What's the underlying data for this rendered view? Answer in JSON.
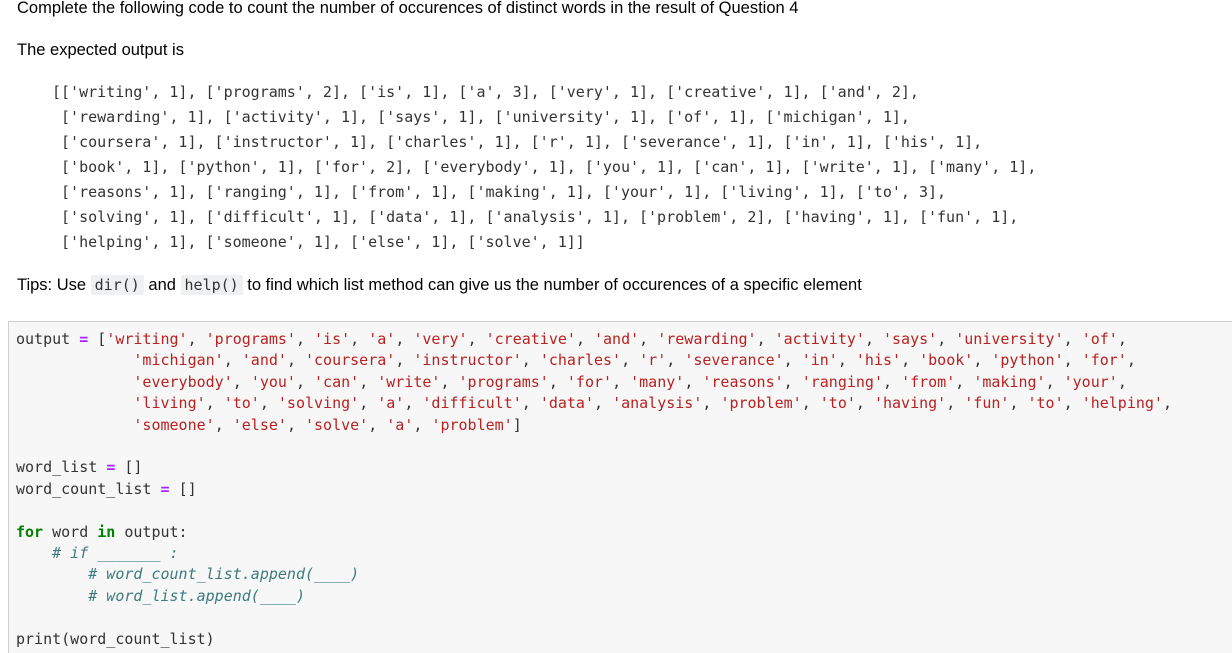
{
  "question_title": "Complete the following code to count the number of occurences of distinct words in the result of Question 4",
  "expected_label": "The expected output is",
  "expected_output_lines": [
    "[['writing', 1], ['programs', 2], ['is', 1], ['a', 3], ['very', 1], ['creative', 1], ['and', 2],",
    " ['rewarding', 1], ['activity', 1], ['says', 1], ['university', 1], ['of', 1], ['michigan', 1],",
    " ['coursera', 1], ['instructor', 1], ['charles', 1], ['r', 1], ['severance', 1], ['in', 1], ['his', 1],",
    " ['book', 1], ['python', 1], ['for', 2], ['everybody', 1], ['you', 1], ['can', 1], ['write', 1], ['many', 1],",
    " ['reasons', 1], ['ranging', 1], ['from', 1], ['making', 1], ['your', 1], ['living', 1], ['to', 3],",
    " ['solving', 1], ['difficult', 1], ['data', 1], ['analysis', 1], ['problem', 2], ['having', 1], ['fun', 1],",
    " ['helping', 1], ['someone', 1], ['else', 1], ['solve', 1]]"
  ],
  "tips": {
    "prefix": "Tips: Use ",
    "code1": "dir()",
    "middle": " and ",
    "code2": "help()",
    "suffix": " to find which list method can give us the number of occurences of a specific element"
  },
  "code_cell": {
    "output_var": "output",
    "output_words": [
      "writing",
      "programs",
      "is",
      "a",
      "very",
      "creative",
      "and",
      "rewarding",
      "activity",
      "says",
      "university",
      "of",
      "michigan",
      "and",
      "coursera",
      "instructor",
      "charles",
      "r",
      "severance",
      "in",
      "his",
      "book",
      "python",
      "for",
      "everybody",
      "you",
      "can",
      "write",
      "programs",
      "for",
      "many",
      "reasons",
      "ranging",
      "from",
      "making",
      "your",
      "living",
      "to",
      "solving",
      "a",
      "difficult",
      "data",
      "analysis",
      "problem",
      "to",
      "having",
      "fun",
      "to",
      "helping",
      "someone",
      "else",
      "solve",
      "a",
      "problem"
    ],
    "line_breaks_after": [
      11,
      23,
      35,
      48
    ],
    "word_list_line": [
      "word_list",
      " = ",
      "[]"
    ],
    "word_count_list_line": [
      "word_count_list",
      " = ",
      "[]"
    ],
    "for_line": [
      "for",
      " word ",
      "in",
      " output:"
    ],
    "comment_if": "# if _______ :",
    "comment_count_append": "# word_count_list.append(____)",
    "comment_list_append": "# word_list.append(____)",
    "print_line": "print(word_count_list)"
  }
}
